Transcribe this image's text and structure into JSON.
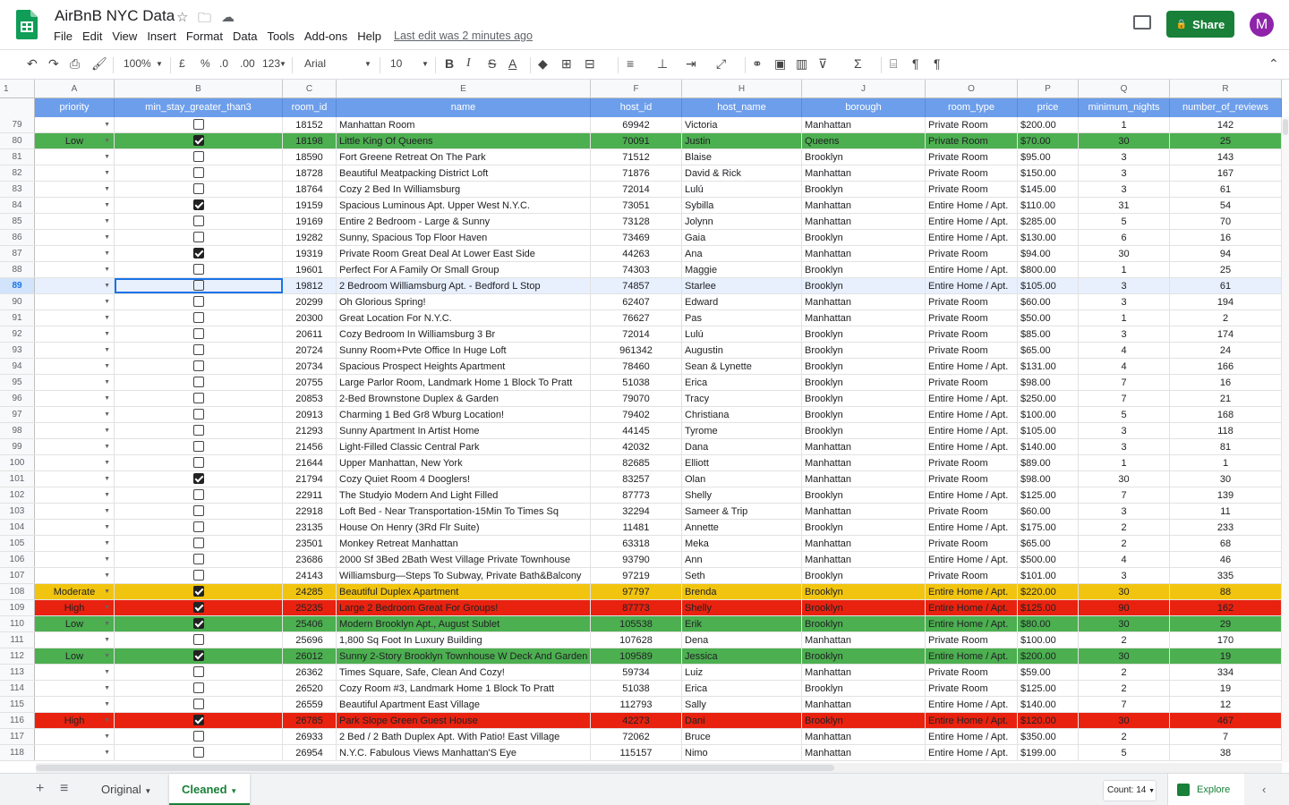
{
  "doc": {
    "title": "AirBnB NYC Data",
    "last_edit": "Last edit was 2 minutes ago",
    "share_label": "Share",
    "avatar_letter": "M"
  },
  "menu": [
    "File",
    "Edit",
    "View",
    "Insert",
    "Format",
    "Data",
    "Tools",
    "Add-ons",
    "Help"
  ],
  "toolbar": {
    "zoom": "100%",
    "currency": "£",
    "percent": "%",
    "dec_less": ".0",
    "dec_more": ".00",
    "format": "123",
    "font": "Arial",
    "size": "10",
    "bold": "B",
    "italic": "I",
    "strike": "S",
    "textcolor": "A"
  },
  "name_box": "1",
  "col_letters": [
    "A",
    "B",
    "C",
    "E",
    "F",
    "H",
    "J",
    "O",
    "P",
    "Q",
    "R"
  ],
  "headers": [
    "priority",
    "min_stay_greater_than3",
    "room_id",
    "name",
    "host_id",
    "host_name",
    "borough",
    "room_type",
    "price",
    "minimum_nights",
    "number_of_reviews"
  ],
  "colors": {
    "low": "#4caf50",
    "moderate": "#f1c40f",
    "high": "#e8220f",
    "header": "#6d9eeb",
    "selected": "#e8f0fe",
    "share": "#188038"
  },
  "rows": [
    {
      "n": "79",
      "p": "",
      "chk": false,
      "id": "18152",
      "name": "Manhattan Room",
      "host_id": "69942",
      "host": "Victoria",
      "boro": "Manhattan",
      "type": "Private Room",
      "price": "$200.00",
      "min": "1",
      "rev": "142"
    },
    {
      "n": "80",
      "p": "Low",
      "chk": true,
      "id": "18198",
      "name": "Little King Of Queens",
      "host_id": "70091",
      "host": "Justin",
      "boro": "Queens",
      "type": "Private Room",
      "price": "$70.00",
      "min": "30",
      "rev": "25"
    },
    {
      "n": "81",
      "p": "",
      "chk": false,
      "id": "18590",
      "name": "Fort Greene Retreat On The Park",
      "host_id": "71512",
      "host": "Blaise",
      "boro": "Brooklyn",
      "type": "Private Room",
      "price": "$95.00",
      "min": "3",
      "rev": "143"
    },
    {
      "n": "82",
      "p": "",
      "chk": false,
      "id": "18728",
      "name": "Beautiful Meatpacking District Loft",
      "host_id": "71876",
      "host": "David & Rick",
      "boro": "Manhattan",
      "type": "Private Room",
      "price": "$150.00",
      "min": "3",
      "rev": "167"
    },
    {
      "n": "83",
      "p": "",
      "chk": false,
      "id": "18764",
      "name": "Cozy 2 Bed In Williamsburg",
      "host_id": "72014",
      "host": "Lulú",
      "boro": "Brooklyn",
      "type": "Private Room",
      "price": "$145.00",
      "min": "3",
      "rev": "61"
    },
    {
      "n": "84",
      "p": "",
      "chk": true,
      "id": "19159",
      "name": "Spacious Luminous Apt. Upper West  N.Y.C.",
      "host_id": "73051",
      "host": "Sybilla",
      "boro": "Manhattan",
      "type": "Entire Home / Apt.",
      "price": "$110.00",
      "min": "31",
      "rev": "54"
    },
    {
      "n": "85",
      "p": "",
      "chk": false,
      "id": "19169",
      "name": "Entire 2 Bedroom - Large & Sunny",
      "host_id": "73128",
      "host": "Jolynn",
      "boro": "Manhattan",
      "type": "Entire Home / Apt.",
      "price": "$285.00",
      "min": "5",
      "rev": "70"
    },
    {
      "n": "86",
      "p": "",
      "chk": false,
      "id": "19282",
      "name": "Sunny, Spacious Top Floor Haven",
      "host_id": "73469",
      "host": "Gaia",
      "boro": "Brooklyn",
      "type": "Entire Home / Apt.",
      "price": "$130.00",
      "min": "6",
      "rev": "16"
    },
    {
      "n": "87",
      "p": "",
      "chk": true,
      "id": "19319",
      "name": "Private Room Great Deal At Lower East Side",
      "host_id": "44263",
      "host": "Ana",
      "boro": "Manhattan",
      "type": "Private Room",
      "price": "$94.00",
      "min": "30",
      "rev": "94"
    },
    {
      "n": "88",
      "p": "",
      "chk": false,
      "id": "19601",
      "name": "Perfect For A Family Or Small Group",
      "host_id": "74303",
      "host": "Maggie",
      "boro": "Brooklyn",
      "type": "Entire Home / Apt.",
      "price": "$800.00",
      "min": "1",
      "rev": "25"
    },
    {
      "n": "89",
      "p": "",
      "chk": false,
      "id": "19812",
      "name": "2 Bedroom Williamsburg Apt. - Bedford L Stop",
      "host_id": "74857",
      "host": "Starlee",
      "boro": "Brooklyn",
      "type": "Entire Home / Apt.",
      "price": "$105.00",
      "min": "3",
      "rev": "61",
      "sel": true
    },
    {
      "n": "90",
      "p": "",
      "chk": false,
      "id": "20299",
      "name": "Oh Glorious Spring!",
      "host_id": "62407",
      "host": "Edward",
      "boro": "Manhattan",
      "type": "Private Room",
      "price": "$60.00",
      "min": "3",
      "rev": "194"
    },
    {
      "n": "91",
      "p": "",
      "chk": false,
      "id": "20300",
      "name": "Great Location For  N.Y.C.",
      "host_id": "76627",
      "host": "Pas",
      "boro": "Manhattan",
      "type": "Private Room",
      "price": "$50.00",
      "min": "1",
      "rev": "2"
    },
    {
      "n": "92",
      "p": "",
      "chk": false,
      "id": "20611",
      "name": "Cozy Bedroom In Williamsburg 3 Br",
      "host_id": "72014",
      "host": "Lulú",
      "boro": "Brooklyn",
      "type": "Private Room",
      "price": "$85.00",
      "min": "3",
      "rev": "174"
    },
    {
      "n": "93",
      "p": "",
      "chk": false,
      "id": "20724",
      "name": "Sunny Room+Pvte Office In Huge Loft",
      "host_id": "961342",
      "host": "Augustin",
      "boro": "Brooklyn",
      "type": "Private Room",
      "price": "$65.00",
      "min": "4",
      "rev": "24"
    },
    {
      "n": "94",
      "p": "",
      "chk": false,
      "id": "20734",
      "name": "Spacious Prospect Heights Apartment",
      "host_id": "78460",
      "host": "Sean & Lynette",
      "boro": "Brooklyn",
      "type": "Entire Home / Apt.",
      "price": "$131.00",
      "min": "4",
      "rev": "166"
    },
    {
      "n": "95",
      "p": "",
      "chk": false,
      "id": "20755",
      "name": "Large Parlor Room, Landmark Home 1 Block To Pratt",
      "host_id": "51038",
      "host": "Erica",
      "boro": "Brooklyn",
      "type": "Private Room",
      "price": "$98.00",
      "min": "7",
      "rev": "16"
    },
    {
      "n": "96",
      "p": "",
      "chk": false,
      "id": "20853",
      "name": "2-Bed Brownstone Duplex & Garden",
      "host_id": "79070",
      "host": "Tracy",
      "boro": "Brooklyn",
      "type": "Entire Home / Apt.",
      "price": "$250.00",
      "min": "7",
      "rev": "21"
    },
    {
      "n": "97",
      "p": "",
      "chk": false,
      "id": "20913",
      "name": "Charming 1 Bed Gr8 Wburg Location!",
      "host_id": "79402",
      "host": "Christiana",
      "boro": "Brooklyn",
      "type": "Entire Home / Apt.",
      "price": "$100.00",
      "min": "5",
      "rev": "168"
    },
    {
      "n": "98",
      "p": "",
      "chk": false,
      "id": "21293",
      "name": "Sunny Apartment In Artist Home",
      "host_id": "44145",
      "host": "Tyrome",
      "boro": "Brooklyn",
      "type": "Entire Home / Apt.",
      "price": "$105.00",
      "min": "3",
      "rev": "118"
    },
    {
      "n": "99",
      "p": "",
      "chk": false,
      "id": "21456",
      "name": "Light-Filled Classic Central Park",
      "host_id": "42032",
      "host": "Dana",
      "boro": "Manhattan",
      "type": "Entire Home / Apt.",
      "price": "$140.00",
      "min": "3",
      "rev": "81"
    },
    {
      "n": "100",
      "p": "",
      "chk": false,
      "id": "21644",
      "name": "Upper Manhattan, New York",
      "host_id": "82685",
      "host": "Elliott",
      "boro": "Manhattan",
      "type": "Private Room",
      "price": "$89.00",
      "min": "1",
      "rev": "1"
    },
    {
      "n": "101",
      "p": "",
      "chk": true,
      "id": "21794",
      "name": "Cozy Quiet Room 4 Dooglers!",
      "host_id": "83257",
      "host": "Olan",
      "boro": "Manhattan",
      "type": "Private Room",
      "price": "$98.00",
      "min": "30",
      "rev": "30"
    },
    {
      "n": "102",
      "p": "",
      "chk": false,
      "id": "22911",
      "name": "The Studyio Modern And Light Filled",
      "host_id": "87773",
      "host": "Shelly",
      "boro": "Brooklyn",
      "type": "Entire Home / Apt.",
      "price": "$125.00",
      "min": "7",
      "rev": "139"
    },
    {
      "n": "103",
      "p": "",
      "chk": false,
      "id": "22918",
      "name": "Loft Bed - Near Transportation-15Min To Times Sq",
      "host_id": "32294",
      "host": "Sameer & Trip",
      "boro": "Manhattan",
      "type": "Private Room",
      "price": "$60.00",
      "min": "3",
      "rev": "11"
    },
    {
      "n": "104",
      "p": "",
      "chk": false,
      "id": "23135",
      "name": "House On Henry (3Rd Flr Suite)",
      "host_id": "11481",
      "host": "Annette",
      "boro": "Brooklyn",
      "type": "Entire Home / Apt.",
      "price": "$175.00",
      "min": "2",
      "rev": "233"
    },
    {
      "n": "105",
      "p": "",
      "chk": false,
      "id": "23501",
      "name": "Monkey Retreat Manhattan",
      "host_id": "63318",
      "host": "Meka",
      "boro": "Manhattan",
      "type": "Private Room",
      "price": "$65.00",
      "min": "2",
      "rev": "68"
    },
    {
      "n": "106",
      "p": "",
      "chk": false,
      "id": "23686",
      "name": "2000 Sf 3Bed 2Bath West Village Private  Townhouse",
      "host_id": "93790",
      "host": "Ann",
      "boro": "Manhattan",
      "type": "Entire Home / Apt.",
      "price": "$500.00",
      "min": "4",
      "rev": "46"
    },
    {
      "n": "107",
      "p": "",
      "chk": false,
      "id": "24143",
      "name": "Williamsburg—Steps To Subway, Private Bath&Balcony",
      "host_id": "97219",
      "host": "Seth",
      "boro": "Brooklyn",
      "type": "Private Room",
      "price": "$101.00",
      "min": "3",
      "rev": "335"
    },
    {
      "n": "108",
      "p": "Moderate",
      "chk": true,
      "id": "24285",
      "name": "Beautiful Duplex Apartment",
      "host_id": "97797",
      "host": "Brenda",
      "boro": "Brooklyn",
      "type": "Entire Home / Apt.",
      "price": "$220.00",
      "min": "30",
      "rev": "88"
    },
    {
      "n": "109",
      "p": "High",
      "chk": true,
      "id": "25235",
      "name": "Large 2 Bedroom Great For Groups!",
      "host_id": "87773",
      "host": "Shelly",
      "boro": "Brooklyn",
      "type": "Entire Home / Apt.",
      "price": "$125.00",
      "min": "90",
      "rev": "162"
    },
    {
      "n": "110",
      "p": "Low",
      "chk": true,
      "id": "25406",
      "name": "Modern Brooklyn Apt., August Sublet",
      "host_id": "105538",
      "host": "Erik",
      "boro": "Brooklyn",
      "type": "Entire Home / Apt.",
      "price": "$80.00",
      "min": "30",
      "rev": "29"
    },
    {
      "n": "111",
      "p": "",
      "chk": false,
      "id": "25696",
      "name": "1,800 Sq Foot In Luxury Building",
      "host_id": "107628",
      "host": "Dena",
      "boro": "Manhattan",
      "type": "Private Room",
      "price": "$100.00",
      "min": "2",
      "rev": "170"
    },
    {
      "n": "112",
      "p": "Low",
      "chk": true,
      "id": "26012",
      "name": "Sunny 2-Story Brooklyn Townhouse W Deck And Garden",
      "host_id": "109589",
      "host": "Jessica",
      "boro": "Brooklyn",
      "type": "Entire Home / Apt.",
      "price": "$200.00",
      "min": "30",
      "rev": "19"
    },
    {
      "n": "113",
      "p": "",
      "chk": false,
      "id": "26362",
      "name": "Times Square, Safe, Clean And Cozy!",
      "host_id": "59734",
      "host": "Luiz",
      "boro": "Manhattan",
      "type": "Private Room",
      "price": "$59.00",
      "min": "2",
      "rev": "334"
    },
    {
      "n": "114",
      "p": "",
      "chk": false,
      "id": "26520",
      "name": "Cozy Room #3, Landmark Home 1 Block To Pratt",
      "host_id": "51038",
      "host": "Erica",
      "boro": "Brooklyn",
      "type": "Private Room",
      "price": "$125.00",
      "min": "2",
      "rev": "19"
    },
    {
      "n": "115",
      "p": "",
      "chk": false,
      "id": "26559",
      "name": "Beautiful Apartment East Village",
      "host_id": "112793",
      "host": "Sally",
      "boro": "Manhattan",
      "type": "Entire Home / Apt.",
      "price": "$140.00",
      "min": "7",
      "rev": "12"
    },
    {
      "n": "116",
      "p": "High",
      "chk": true,
      "id": "26785",
      "name": "Park Slope Green Guest House",
      "host_id": "42273",
      "host": "Dani",
      "boro": "Brooklyn",
      "type": "Entire Home / Apt.",
      "price": "$120.00",
      "min": "30",
      "rev": "467"
    },
    {
      "n": "117",
      "p": "",
      "chk": false,
      "id": "26933",
      "name": "2 Bed / 2 Bath Duplex Apt. With Patio! East Village",
      "host_id": "72062",
      "host": "Bruce",
      "boro": "Manhattan",
      "type": "Entire Home / Apt.",
      "price": "$350.00",
      "min": "2",
      "rev": "7"
    },
    {
      "n": "118",
      "p": "",
      "chk": false,
      "id": "26954",
      "name": " N.Y.C.  Fabulous Views Manhattan'S Eye",
      "host_id": "115157",
      "host": "Nimo",
      "boro": "Manhattan",
      "type": "Entire Home / Apt.",
      "price": "$199.00",
      "min": "5",
      "rev": "38"
    }
  ],
  "sheets": {
    "tabs": [
      "Original",
      "Cleaned"
    ],
    "active": "Cleaned"
  },
  "status": {
    "count": "Count: 14",
    "explore": "Explore"
  }
}
